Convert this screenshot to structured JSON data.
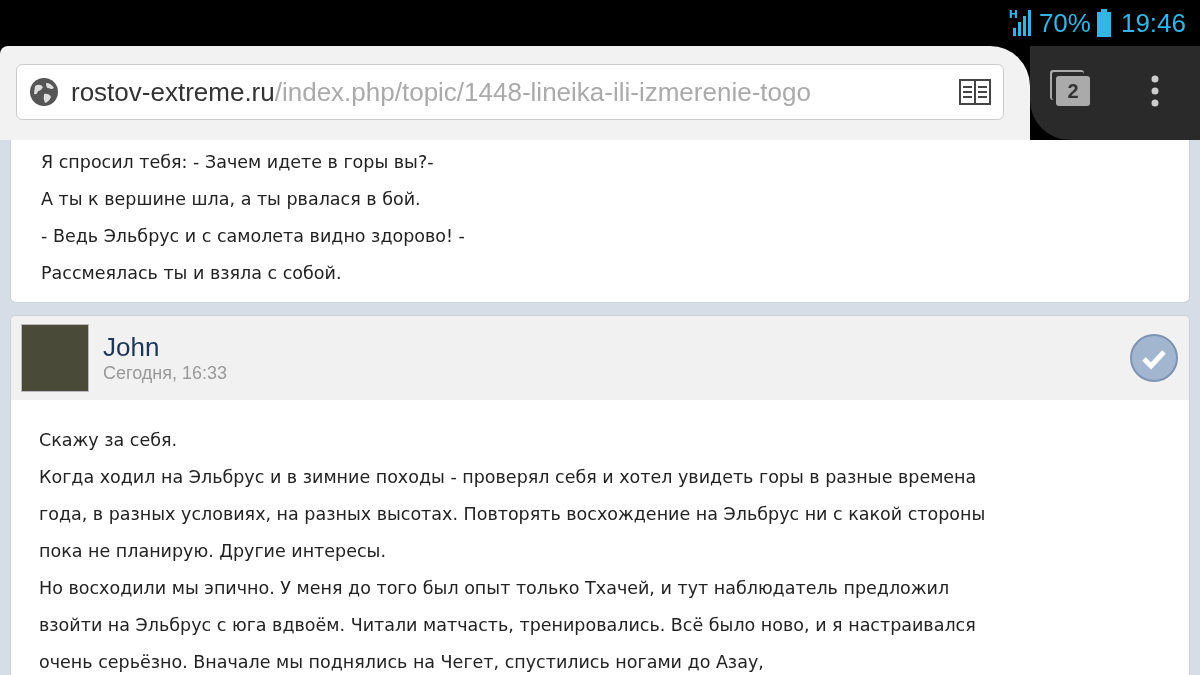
{
  "status_bar": {
    "network": "H",
    "battery": "70%",
    "time": "19:46"
  },
  "browser": {
    "url_domain": "rostov-extreme.ru",
    "url_path": "/index.php/topic/1448-lineika-ili-izmerenie-togo",
    "tab_count": "2"
  },
  "posts": [
    {
      "kind": "cut",
      "lines": [
        "Я спросил тебя: - Зачем идете в горы вы?-",
        "А ты к вершине шла, а ты рвалася в бой.",
        "- Ведь Эльбрус и с самолета видно здорово! -",
        "Рассмеялась ты и взяла с собой."
      ]
    },
    {
      "kind": "full",
      "author": "John",
      "time": "Сегодня, 16:33",
      "marked": true,
      "lines": [
        "Скажу за себя.",
        "Когда ходил на Эльбрус и в зимние походы - проверял себя и хотел увидеть горы в разные времена года, в разных условиях, на разных высотах. Повторять восхождение на Эльбрус ни с какой стороны пока не планирую. Другие интересы.",
        "Но восходили мы эпично. У меня до того был опыт только Тхачей, и тут наблюдатель предложил взойти на Эльбрус с юга вдвоём. Читали матчасть, тренировались. Всё было ново, и я настраивался очень серьёзно. Вначале мы поднялись на Чегет, спустились ногами до Азау,"
      ]
    }
  ]
}
